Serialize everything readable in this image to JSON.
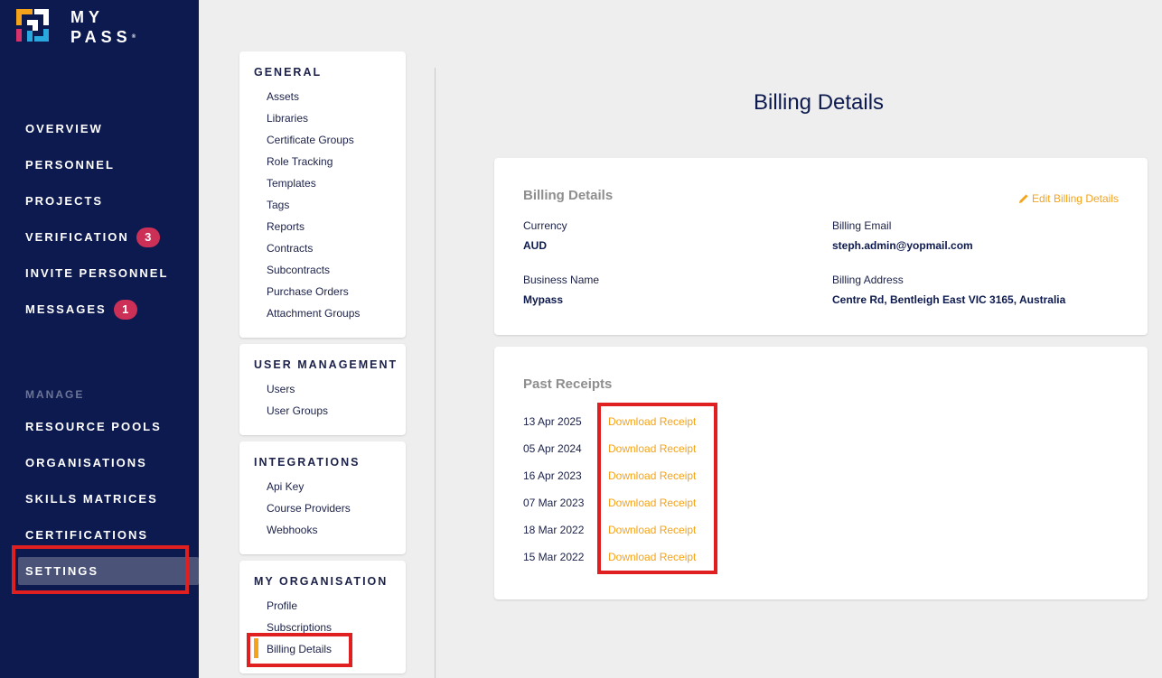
{
  "brand": {
    "line1": "MY",
    "line2": "PASS",
    "mark": "®"
  },
  "sidebar": {
    "items": [
      {
        "label": "OVERVIEW"
      },
      {
        "label": "PERSONNEL"
      },
      {
        "label": "PROJECTS"
      },
      {
        "label": "VERIFICATION",
        "badge": "3"
      },
      {
        "label": "INVITE PERSONNEL"
      },
      {
        "label": "MESSAGES",
        "badge": "1"
      }
    ],
    "section_label": "MANAGE",
    "manage_items": [
      {
        "label": "RESOURCE POOLS"
      },
      {
        "label": "ORGANISATIONS"
      },
      {
        "label": "SKILLS MATRICES"
      },
      {
        "label": "CERTIFICATIONS"
      },
      {
        "label": "SETTINGS"
      }
    ],
    "active": "SETTINGS"
  },
  "settings_menu": {
    "general": {
      "title": "GENERAL",
      "links": [
        "Assets",
        "Libraries",
        "Certificate Groups",
        "Role Tracking",
        "Templates",
        "Tags",
        "Reports",
        "Contracts",
        "Subcontracts",
        "Purchase Orders",
        "Attachment Groups"
      ]
    },
    "user_management": {
      "title": "USER MANAGEMENT",
      "links": [
        "Users",
        "User Groups"
      ]
    },
    "integrations": {
      "title": "INTEGRATIONS",
      "links": [
        "Api Key",
        "Course Providers",
        "Webhooks"
      ]
    },
    "my_organisation": {
      "title": "MY ORGANISATION",
      "links": [
        "Profile",
        "Subscriptions",
        "Billing Details"
      ],
      "active": "Billing Details"
    }
  },
  "main": {
    "title": "Billing Details",
    "billing_card": {
      "heading": "Billing Details",
      "edit_label": "Edit Billing Details",
      "currency_label": "Currency",
      "currency_value": "AUD",
      "email_label": "Billing Email",
      "email_value": "steph.admin@yopmail.com",
      "business_label": "Business Name",
      "business_value": "Mypass",
      "address_label": "Billing Address",
      "address_value": "Centre Rd, Bentleigh East VIC 3165, Australia"
    },
    "receipts_card": {
      "heading": "Past Receipts",
      "receipts": [
        {
          "date": "13 Apr 2025",
          "link": "Download Receipt"
        },
        {
          "date": "05 Apr 2024",
          "link": "Download Receipt"
        },
        {
          "date": "16 Apr 2023",
          "link": "Download Receipt"
        },
        {
          "date": "07 Mar 2023",
          "link": "Download Receipt"
        },
        {
          "date": "18 Mar 2022",
          "link": "Download Receipt"
        },
        {
          "date": "15 Mar 2022",
          "link": "Download Receipt"
        }
      ]
    }
  },
  "colors": {
    "sidebar_bg": "#0d1a4f",
    "accent": "#f5a31a",
    "badge": "#cc3057",
    "highlight_box": "#e02020"
  }
}
